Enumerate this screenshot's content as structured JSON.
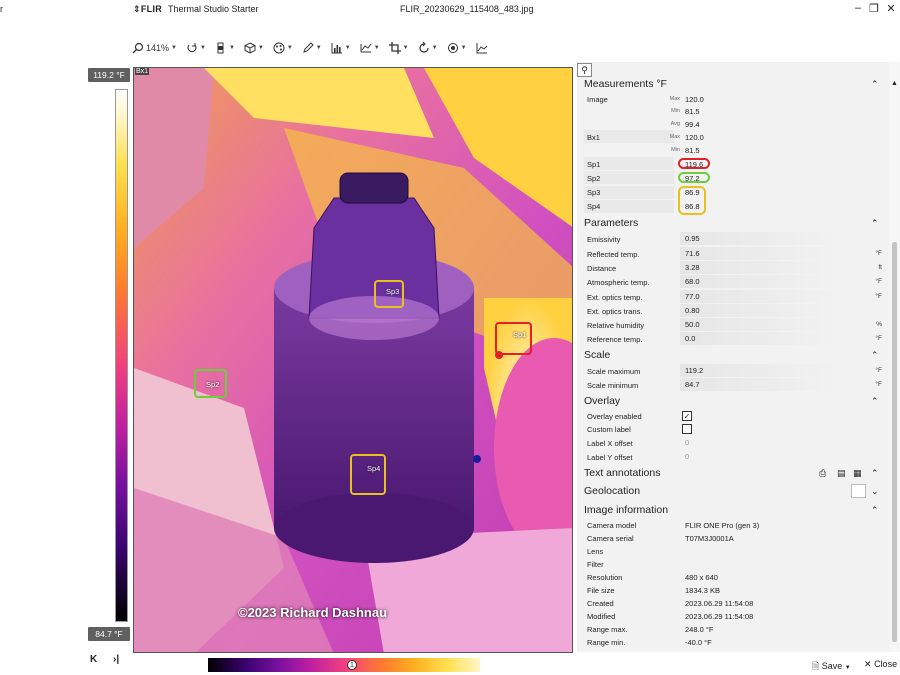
{
  "titlebar": {
    "left_fragment": "r",
    "brand": "FLIR",
    "app_name": "Thermal Studio Starter",
    "file_name": "FLIR_20230629_115408_483.jpg",
    "minimize": "–",
    "maximize": "❐",
    "close": "✕"
  },
  "toolbar": {
    "zoom": "141%",
    "dd": "▼"
  },
  "scale": {
    "max_label": "119.2 °F",
    "min_label": "84.7 °F"
  },
  "navigation": {
    "first": "K",
    "last": "›|"
  },
  "image": {
    "box_label": "Bx1",
    "copyright": "©2023 Richard Dashnau",
    "spots": [
      {
        "label": "Sp1",
        "color": "#e0202a"
      },
      {
        "label": "Sp2",
        "color": "#6ccf3a"
      },
      {
        "label": "Sp3",
        "color": "#e8c020"
      },
      {
        "label": "Sp4",
        "color": "#e8c020"
      }
    ]
  },
  "palette": {
    "handle_label": "1"
  },
  "panel": {
    "measurements": {
      "title": "Measurements °F",
      "caret": "⌃",
      "rows": [
        {
          "label": "Image",
          "stat": "Max",
          "value": "120.0"
        },
        {
          "label": "",
          "stat": "Min",
          "value": "81.5"
        },
        {
          "label": "",
          "stat": "Avg",
          "value": "99.4"
        },
        {
          "label": "Bx1",
          "stat": "Max",
          "value": "120.0"
        },
        {
          "label": "",
          "stat": "Min",
          "value": "81.5"
        },
        {
          "label": "Sp1",
          "stat": "",
          "value": "119.6"
        },
        {
          "label": "Sp2",
          "stat": "",
          "value": "97.2"
        },
        {
          "label": "Sp3",
          "stat": "",
          "value": "86.9"
        },
        {
          "label": "Sp4",
          "stat": "",
          "value": "86.8"
        }
      ]
    },
    "parameters": {
      "title": "Parameters",
      "rows": [
        {
          "label": "Emissivity",
          "value": "0.95",
          "unit": ""
        },
        {
          "label": "Reflected temp.",
          "value": "71.6",
          "unit": "°F"
        },
        {
          "label": "Distance",
          "value": "3.28",
          "unit": "ft"
        },
        {
          "label": "Atmospheric temp.",
          "value": "68.0",
          "unit": "°F"
        },
        {
          "label": "Ext. optics temp.",
          "value": "77.0",
          "unit": "°F"
        },
        {
          "label": "Ext. optics trans.",
          "value": "0.80",
          "unit": ""
        },
        {
          "label": "Relative humidity",
          "value": "50.0",
          "unit": "%"
        },
        {
          "label": "Reference temp.",
          "value": "0.0",
          "unit": "°F"
        }
      ]
    },
    "scale": {
      "title": "Scale",
      "rows": [
        {
          "label": "Scale maximum",
          "value": "119.2",
          "unit": "°F"
        },
        {
          "label": "Scale minimum",
          "value": "84.7",
          "unit": "°F"
        }
      ]
    },
    "overlay": {
      "title": "Overlay",
      "rows": [
        {
          "label": "Overlay enabled",
          "checked": true
        },
        {
          "label": "Custom label",
          "checked": false
        },
        {
          "label": "Label X offset",
          "value": "0"
        },
        {
          "label": "Label Y offset",
          "value": "0"
        }
      ],
      "check_glyph": "✓"
    },
    "text_annotations": {
      "title": "Text annotations"
    },
    "geolocation": {
      "title": "Geolocation"
    },
    "image_information": {
      "title": "Image information",
      "rows": [
        {
          "label": "Camera model",
          "value": "FLIR ONE Pro (gen 3)"
        },
        {
          "label": "Camera serial",
          "value": "T07M3J0001A"
        },
        {
          "label": "Lens",
          "value": ""
        },
        {
          "label": "Filter",
          "value": ""
        },
        {
          "label": "Resolution",
          "value": "480 x 640"
        },
        {
          "label": "File size",
          "value": "1834.3 KB"
        },
        {
          "label": "Created",
          "value": "2023.06.29 11:54:08"
        },
        {
          "label": "Modified",
          "value": "2023.06.29 11:54:08"
        },
        {
          "label": "Range max.",
          "value": "248.0 °F"
        },
        {
          "label": "Range min.",
          "value": "-40.0 °F"
        }
      ]
    }
  },
  "bottom": {
    "save": "Save",
    "close": "Close"
  }
}
